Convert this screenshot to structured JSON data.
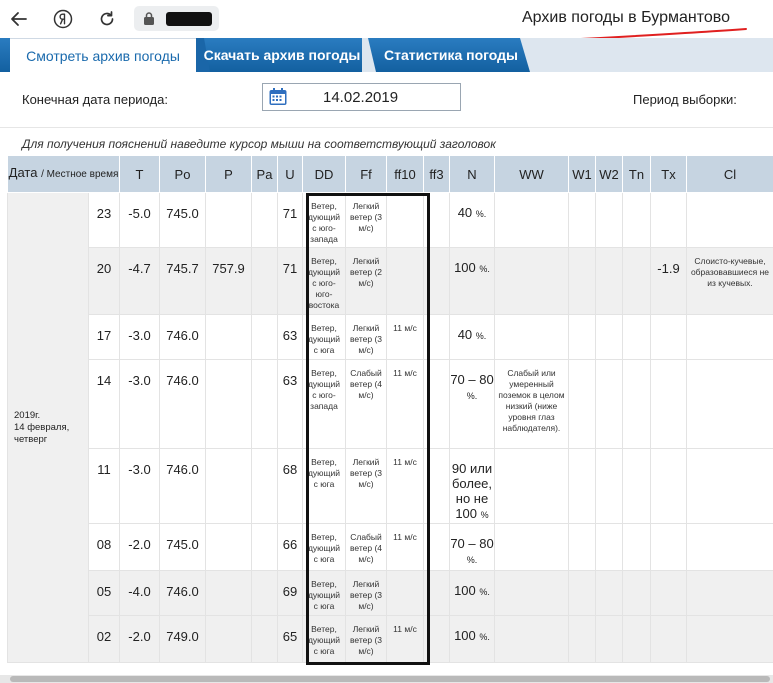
{
  "browser": {
    "back_icon": "back-arrow-icon",
    "yandex_icon": "yandex-logo-icon",
    "reload_icon": "reload-icon",
    "lock_icon": "lock-icon",
    "tab_title": "Архив погоды в Бурмантово",
    "annotation_color": "#e02020"
  },
  "tabs": {
    "view": "Смотреть архив погоды",
    "download": "Скачать архив погоды",
    "stats": "Статистика погоды"
  },
  "filter": {
    "end_date_label": "Конечная дата периода:",
    "end_date_value": "14.02.2019",
    "period_label": "Период выборки:"
  },
  "hint": "Для получения пояснений наведите курсор мыши на соответствующий заголовок",
  "table": {
    "headers": {
      "date": "Дата",
      "local_time": "/ Местное время",
      "T": "T",
      "Po": "Po",
      "P": "P",
      "Pa": "Pa",
      "U": "U",
      "DD": "DD",
      "Ff": "Ff",
      "ff10": "ff10",
      "ff3": "ff3",
      "N": "N",
      "WW": "WW",
      "W1": "W1",
      "W2": "W2",
      "Tn": "Tn",
      "Tx": "Tx",
      "Cl": "Cl"
    },
    "date_cell": [
      "2019г.",
      "14 февраля,",
      "четверг"
    ],
    "rows": [
      {
        "hour": "23",
        "T": "-5.0",
        "Po": "745.0",
        "P": "",
        "U": "71",
        "DD": "Ветер, дующий с юго-запада",
        "Ff": "Легкий ветер (3 м/с)",
        "ff10": "",
        "N": "40",
        "N_unit": "%.",
        "WW": "",
        "Tx": "",
        "Cl": ""
      },
      {
        "hour": "20",
        "T": "-4.7",
        "Po": "745.7",
        "P": "757.9",
        "U": "71",
        "DD": "Ветер, дующий с юго-юго-востока",
        "Ff": "Легкий ветер (2 м/с)",
        "ff10": "",
        "N": "100",
        "N_unit": "%.",
        "WW": "",
        "Tx": "-1.9",
        "Cl": "Слоисто-кучевые, образовавшиеся не из кучевых."
      },
      {
        "hour": "17",
        "T": "-3.0",
        "Po": "746.0",
        "P": "",
        "U": "63",
        "DD": "Ветер, дующий с юга",
        "Ff": "Легкий ветер (3 м/с)",
        "ff10": "11 м/с",
        "N": "40",
        "N_unit": "%.",
        "WW": "",
        "Tx": "",
        "Cl": ""
      },
      {
        "hour": "14",
        "T": "-3.0",
        "Po": "746.0",
        "P": "",
        "U": "63",
        "DD": "Ветер, дующий с юго-запада",
        "Ff": "Слабый ветер (4 м/с)",
        "ff10": "11 м/с",
        "N": "70 – 80",
        "N_unit": "%.",
        "WW": "Слабый или умеренный поземок в целом низкий (ниже уровня глаз наблюдателя).",
        "Tx": "",
        "Cl": ""
      },
      {
        "hour": "11",
        "T": "-3.0",
        "Po": "746.0",
        "P": "",
        "U": "68",
        "DD": "Ветер, дующий с юга",
        "Ff": "Легкий ветер (3 м/с)",
        "ff10": "11 м/с",
        "N": "90 или более, но не 100",
        "N_unit": "%",
        "WW": "",
        "Tx": "",
        "Cl": ""
      },
      {
        "hour": "08",
        "T": "-2.0",
        "Po": "745.0",
        "P": "",
        "U": "66",
        "DD": "Ветер, дующий с юга",
        "Ff": "Слабый ветер (4 м/с)",
        "ff10": "11 м/с",
        "N": "70 – 80",
        "N_unit": "%.",
        "WW": "",
        "Tx": "",
        "Cl": ""
      },
      {
        "hour": "05",
        "T": "-4.0",
        "Po": "746.0",
        "P": "",
        "U": "69",
        "DD": "Ветер, дующий с юга",
        "Ff": "Легкий ветер (3 м/с)",
        "ff10": "",
        "N": "100",
        "N_unit": "%.",
        "WW": "",
        "Tx": "",
        "Cl": ""
      },
      {
        "hour": "02",
        "T": "-2.0",
        "Po": "749.0",
        "P": "",
        "U": "65",
        "DD": "Ветер, дующий с юга",
        "Ff": "Легкий ветер (3 м/с)",
        "ff10": "11 м/с",
        "N": "100",
        "N_unit": "%.",
        "WW": "",
        "Tx": "",
        "Cl": ""
      }
    ]
  }
}
